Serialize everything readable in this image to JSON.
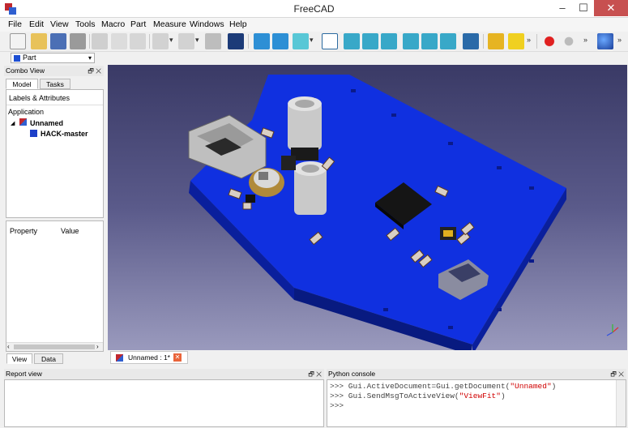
{
  "window": {
    "title": "FreeCAD",
    "colors": {
      "close": "#c75050",
      "accent": "#1d4fd3"
    }
  },
  "menu": [
    "File",
    "Edit",
    "View",
    "Tools",
    "Macro",
    "Part",
    "Measure",
    "Windows",
    "Help"
  ],
  "workbench": {
    "selected": "Part"
  },
  "combo": {
    "title": "Combo View",
    "tabs": [
      "Model",
      "Tasks"
    ],
    "labels_header": "Labels & Attributes",
    "application": "Application",
    "document": "Unnamed",
    "object": "HACK-master",
    "prop_cols": [
      "Property",
      "Value"
    ],
    "bottom_tabs": [
      "View",
      "Data"
    ]
  },
  "doc_tab": {
    "label": "Unnamed : 1*"
  },
  "report": {
    "title": "Report view"
  },
  "python": {
    "title": "Python console",
    "lines": [
      {
        "prompt": ">>>",
        "code": " Gui.ActiveDocument=Gui.getDocument(",
        "arg": "\"Unnamed\"",
        "end": ")"
      },
      {
        "prompt": ">>>",
        "code": " Gui.SendMsgToActiveView(",
        "arg": "\"ViewFit\"",
        "end": ")"
      },
      {
        "prompt": ">>>",
        "code": "",
        "arg": "",
        "end": ""
      }
    ]
  }
}
